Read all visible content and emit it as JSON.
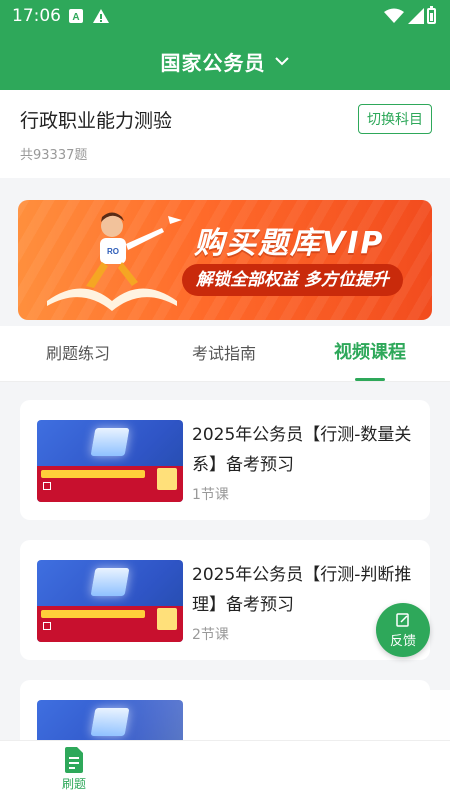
{
  "status_bar": {
    "time": "17:06"
  },
  "header": {
    "title": "国家公务员",
    "chevron_icon": "chevron-down-icon"
  },
  "subject": {
    "name": "行政职业能力测验",
    "count": "共93337题",
    "switch_label": "切换科目"
  },
  "banner": {
    "headline": "购买题库VIP",
    "subline": "解锁全部权益 多方位提升"
  },
  "tabs": [
    {
      "label": "刷题练习",
      "active": false
    },
    {
      "label": "考试指南",
      "active": false
    },
    {
      "label": "视频课程",
      "active": true
    }
  ],
  "courses": [
    {
      "title": "2025年公务员【行测-数量关系】备考预习",
      "lessons": "1节课"
    },
    {
      "title": "2025年公务员【行测-判断推理】备考预习",
      "lessons": "2节课"
    },
    {
      "title": "",
      "lessons": ""
    }
  ],
  "feedback": {
    "label": "反馈"
  },
  "bottom_nav": {
    "items": [
      {
        "label": "刷题",
        "icon": "document-icon",
        "active": true
      }
    ]
  },
  "colors": {
    "primary": "#2ea85a",
    "banner": "#ff6a2a"
  }
}
